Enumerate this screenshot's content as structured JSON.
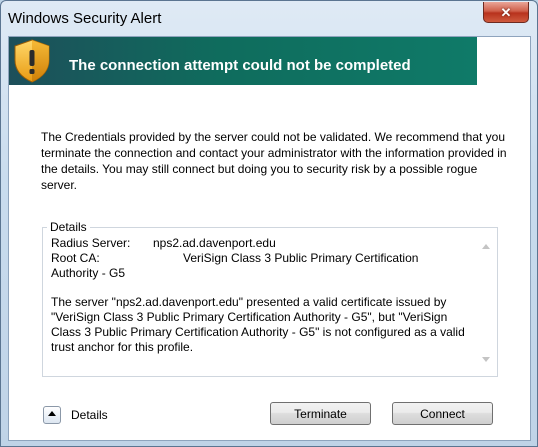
{
  "window": {
    "title": "Windows Security Alert",
    "close_glyph": "✕"
  },
  "banner": {
    "icon": "shield-warning-icon",
    "heading": "The connection attempt could not be completed"
  },
  "message": "The Credentials provided by the server could not be validated. We recommend that you terminate the connection and contact your administrator with the information provided in the details. You may still connect but doing you to security risk by a possible rogue server.",
  "details": {
    "legend": "Details",
    "radius_label": "Radius Server:",
    "radius_value": "nps2.ad.davenport.edu",
    "rootca_label": "Root CA:",
    "rootca_value": "VeriSign Class 3 Public Primary Certification",
    "rootca_value_cont": "Authority - G5",
    "paragraph": "The server \"nps2.ad.davenport.edu\" presented a valid certificate issued by \"VeriSign Class 3 Public Primary Certification Authority - G5\", but \"VeriSign Class 3 Public Primary Certification Authority - G5\" is not configured as a valid trust anchor for this profile."
  },
  "footer": {
    "details_toggle_label": "Details",
    "terminate_label": "Terminate",
    "connect_label": "Connect"
  },
  "colors": {
    "banner_start": "#1d4f5a",
    "banner_end": "#0f7a68",
    "close_red": "#c0392b"
  }
}
